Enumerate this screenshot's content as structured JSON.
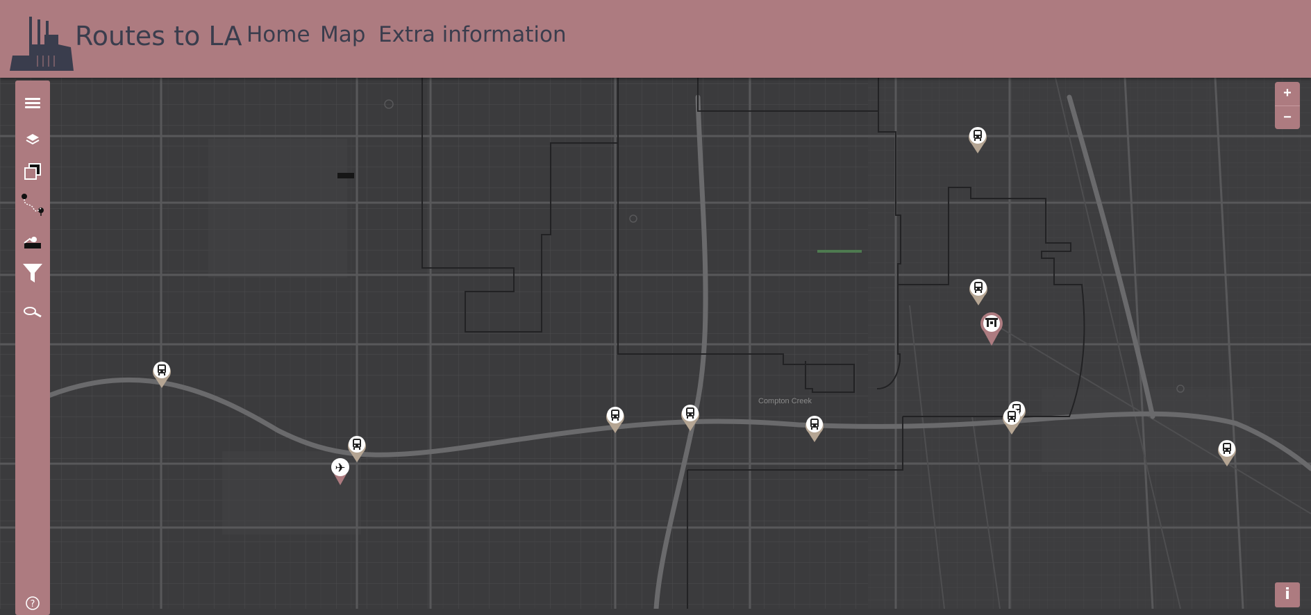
{
  "app": {
    "brand": "Routes to LA"
  },
  "nav": {
    "home": "Home",
    "map": "Map",
    "extra": "Extra information"
  },
  "map": {
    "area_label": "Compton Creek"
  },
  "zoom": {
    "in_label": "+",
    "out_label": "−"
  },
  "info": {
    "label": "i"
  },
  "help": {
    "label": "?"
  },
  "colors": {
    "navbar": "#ad7b80",
    "sidebar": "#ad7b80",
    "text": "#3a3d4d",
    "map_bg": "#3a3a3c",
    "marker": "#b5a593",
    "hub_marker": "#ad7b80"
  },
  "sidebar_tools": [
    "layers-list-icon",
    "basemap-icon",
    "overlay-icon",
    "route-icon",
    "measure-icon",
    "filter-icon",
    "search-icon"
  ],
  "markers": [
    "bus-stop",
    "bus-stop",
    "bus-stop",
    "bus-stop",
    "bus-stop",
    "bus-stop",
    "bus-stop",
    "bus-stop",
    "bus-stop",
    "bus-stop",
    "bus-stop",
    "airport",
    "rail-station"
  ]
}
